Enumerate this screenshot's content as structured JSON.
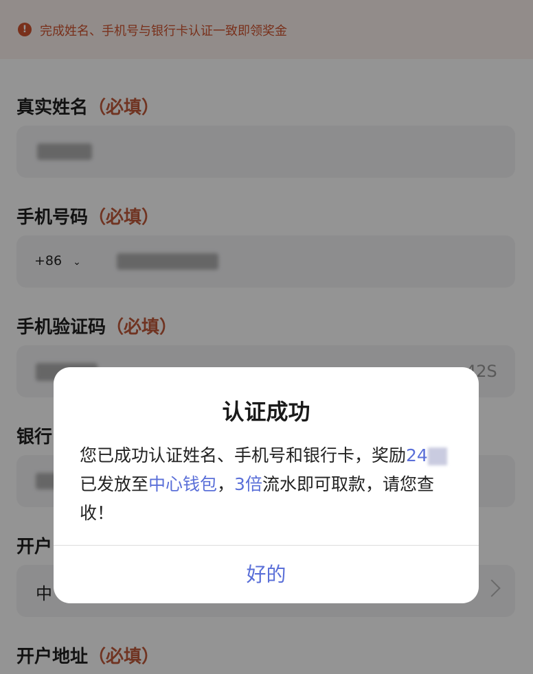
{
  "notice": {
    "text": "完成姓名、手机号与银行卡认证一致即领奖金",
    "icon": "alert-icon"
  },
  "required_mark": "（必填）",
  "fields": {
    "real_name": {
      "label": "真实姓名"
    },
    "phone": {
      "label": "手机号码",
      "country_code": "+86",
      "chevron": "⌄"
    },
    "sms_code": {
      "label": "手机验证码",
      "timer": "42S"
    },
    "bank_card": {
      "label": "银行"
    },
    "bank_name": {
      "label": "开户",
      "value": "中"
    },
    "bank_address": {
      "label": "开户地址"
    }
  },
  "dialog": {
    "title": "认证成功",
    "body_1": "您已成功认证姓名、手机号和银行卡，奖励",
    "amount": "24",
    "body_2": "已发放至",
    "wallet": "中心钱包",
    "sep": "，",
    "multiplier": "3倍",
    "body_3": "流水即可取款，请您查收！",
    "confirm": "好的"
  },
  "colors": {
    "accent": "#5a6fd8",
    "warning": "#d0542f",
    "required": "#c15b3b"
  }
}
